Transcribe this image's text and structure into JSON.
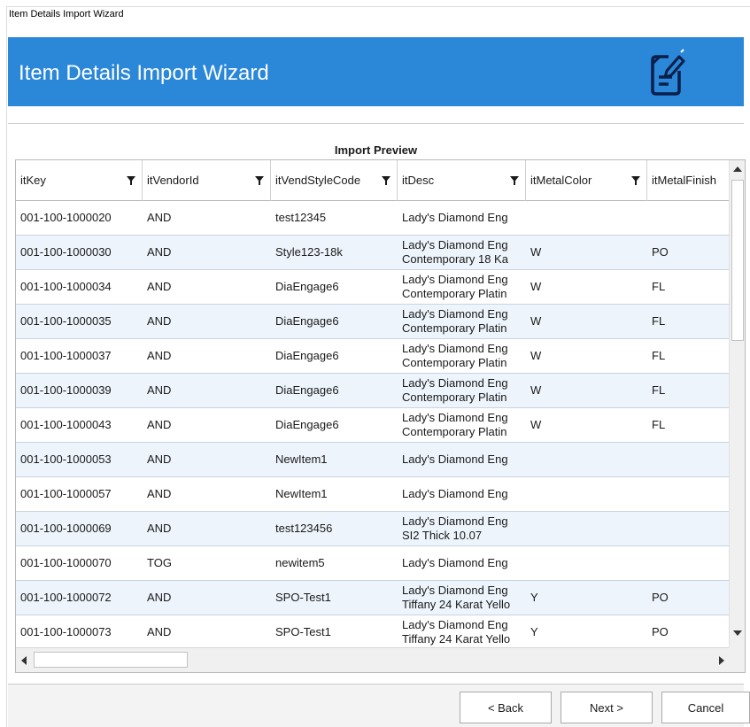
{
  "window": {
    "title": "Item Details Import Wizard"
  },
  "banner": {
    "title": "Item Details Import Wizard",
    "icon": "edit-document-icon",
    "color": "#2b87d8"
  },
  "preview": {
    "title": "Import Preview"
  },
  "grid": {
    "columns": [
      {
        "label": "itKey"
      },
      {
        "label": "itVendorId"
      },
      {
        "label": "itVendStyleCode"
      },
      {
        "label": "itDesc"
      },
      {
        "label": "itMetalColor"
      },
      {
        "label": "itMetalFinish"
      }
    ],
    "rows": [
      {
        "itKey": "001-100-1000020",
        "itVendorId": "AND",
        "itVendStyleCode": "test12345",
        "itDesc": [
          "Lady's Diamond Eng"
        ],
        "itMetalColor": "",
        "itMetalFinish": ""
      },
      {
        "itKey": "001-100-1000030",
        "itVendorId": "AND",
        "itVendStyleCode": "Style123-18k",
        "itDesc": [
          "Lady's Diamond Eng",
          "Contemporary 18 Ka"
        ],
        "itMetalColor": "W",
        "itMetalFinish": "PO"
      },
      {
        "itKey": "001-100-1000034",
        "itVendorId": "AND",
        "itVendStyleCode": "DiaEngage6",
        "itDesc": [
          "Lady's Diamond Eng",
          "Contemporary Platin"
        ],
        "itMetalColor": "W",
        "itMetalFinish": "FL"
      },
      {
        "itKey": "001-100-1000035",
        "itVendorId": "AND",
        "itVendStyleCode": "DiaEngage6",
        "itDesc": [
          "Lady's Diamond Eng",
          "Contemporary Platin"
        ],
        "itMetalColor": "W",
        "itMetalFinish": "FL"
      },
      {
        "itKey": "001-100-1000037",
        "itVendorId": "AND",
        "itVendStyleCode": "DiaEngage6",
        "itDesc": [
          "Lady's Diamond Eng",
          "Contemporary Platin"
        ],
        "itMetalColor": "W",
        "itMetalFinish": "FL"
      },
      {
        "itKey": "001-100-1000039",
        "itVendorId": "AND",
        "itVendStyleCode": "DiaEngage6",
        "itDesc": [
          "Lady's Diamond Eng",
          "Contemporary Platin"
        ],
        "itMetalColor": "W",
        "itMetalFinish": "FL"
      },
      {
        "itKey": "001-100-1000043",
        "itVendorId": "AND",
        "itVendStyleCode": "DiaEngage6",
        "itDesc": [
          "Lady's Diamond Eng",
          "Contemporary Platin"
        ],
        "itMetalColor": "W",
        "itMetalFinish": "FL"
      },
      {
        "itKey": "001-100-1000053",
        "itVendorId": "AND",
        "itVendStyleCode": "NewItem1",
        "itDesc": [
          "Lady's Diamond Eng"
        ],
        "itMetalColor": "",
        "itMetalFinish": ""
      },
      {
        "itKey": "001-100-1000057",
        "itVendorId": "AND",
        "itVendStyleCode": "NewItem1",
        "itDesc": [
          "Lady's Diamond Eng"
        ],
        "itMetalColor": "",
        "itMetalFinish": ""
      },
      {
        "itKey": "001-100-1000069",
        "itVendorId": "AND",
        "itVendStyleCode": "test123456",
        "itDesc": [
          "Lady's Diamond Eng",
          "SI2 Thick 10.07"
        ],
        "itMetalColor": "",
        "itMetalFinish": ""
      },
      {
        "itKey": "001-100-1000070",
        "itVendorId": "TOG",
        "itVendStyleCode": "newitem5",
        "itDesc": [
          "Lady's Diamond Eng"
        ],
        "itMetalColor": "",
        "itMetalFinish": ""
      },
      {
        "itKey": "001-100-1000072",
        "itVendorId": "AND",
        "itVendStyleCode": "SPO-Test1",
        "itDesc": [
          "Lady's Diamond Eng",
          "Tiffany 24 Karat Yello"
        ],
        "itMetalColor": "Y",
        "itMetalFinish": "PO"
      },
      {
        "itKey": "001-100-1000073",
        "itVendorId": "AND",
        "itVendStyleCode": "SPO-Test1",
        "itDesc": [
          "Lady's Diamond Eng",
          "Tiffany 24 Karat Yello"
        ],
        "itMetalColor": "Y",
        "itMetalFinish": "PO"
      }
    ]
  },
  "buttons": {
    "back": "< Back",
    "next": "Next >",
    "cancel": "Cancel"
  }
}
